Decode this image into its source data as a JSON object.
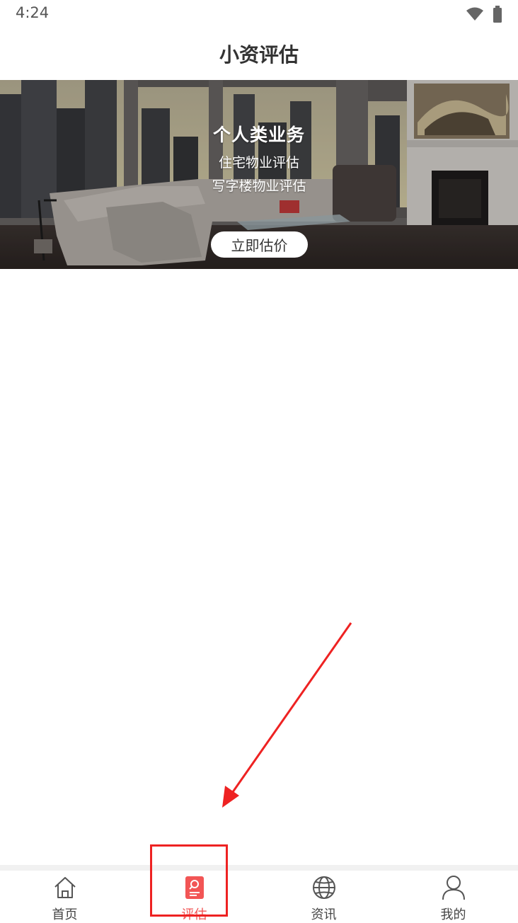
{
  "status_bar": {
    "time": "4:24",
    "icons": [
      "wifi-icon",
      "battery-icon"
    ]
  },
  "header": {
    "title": "小资评估"
  },
  "banner": {
    "title": "个人类业务",
    "lines": [
      "住宅物业评估",
      "写字楼物业评估"
    ],
    "button_label": "立即估价"
  },
  "tab_bar": {
    "items": [
      {
        "label": "首页",
        "icon": "home-icon",
        "active": false
      },
      {
        "label": "评估",
        "icon": "evaluate-icon",
        "active": true
      },
      {
        "label": "资讯",
        "icon": "globe-icon",
        "active": false
      },
      {
        "label": "我的",
        "icon": "user-icon",
        "active": false
      }
    ]
  },
  "colors": {
    "accent": "#f25555",
    "annotation": "#ee2222"
  }
}
